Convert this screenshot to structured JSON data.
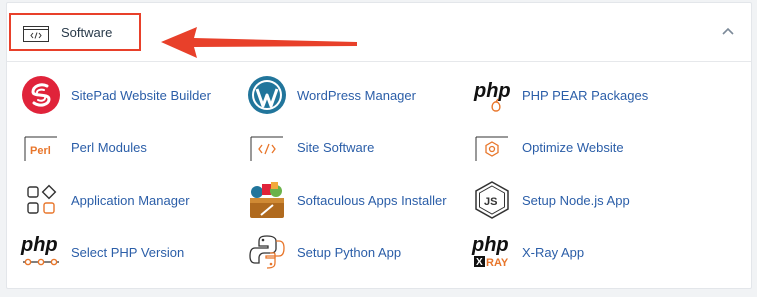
{
  "section": {
    "title": "Software",
    "icon": "code-window-icon",
    "collapse_icon": "chevron-up-icon",
    "highlight_color": "#e8402a",
    "pointer": "arrow-left-icon"
  },
  "items": [
    {
      "label": "SitePad Website Builder",
      "icon": "sitepad-icon"
    },
    {
      "label": "WordPress Manager",
      "icon": "wordpress-icon"
    },
    {
      "label": "PHP PEAR Packages",
      "icon": "php-pear-icon"
    },
    {
      "label": "Perl Modules",
      "icon": "perl-icon",
      "icon_text": "Perl"
    },
    {
      "label": "Site Software",
      "icon": "site-software-icon"
    },
    {
      "label": "Optimize Website",
      "icon": "optimize-website-icon"
    },
    {
      "label": "Application Manager",
      "icon": "application-manager-icon"
    },
    {
      "label": "Softaculous Apps Installer",
      "icon": "softaculous-icon"
    },
    {
      "label": "Setup Node.js App",
      "icon": "nodejs-icon",
      "icon_text": "JS"
    },
    {
      "label": "Select PHP Version",
      "icon": "select-php-version-icon",
      "icon_text": "php"
    },
    {
      "label": "Setup Python App",
      "icon": "python-icon"
    },
    {
      "label": "X-Ray App",
      "icon": "xray-icon",
      "icon_text": "XRAY"
    }
  ],
  "colors": {
    "link": "#2b5ea8",
    "accent_orange": "#e8762b",
    "sitepad_red": "#e0233a",
    "wordpress_blue": "#21759b"
  }
}
